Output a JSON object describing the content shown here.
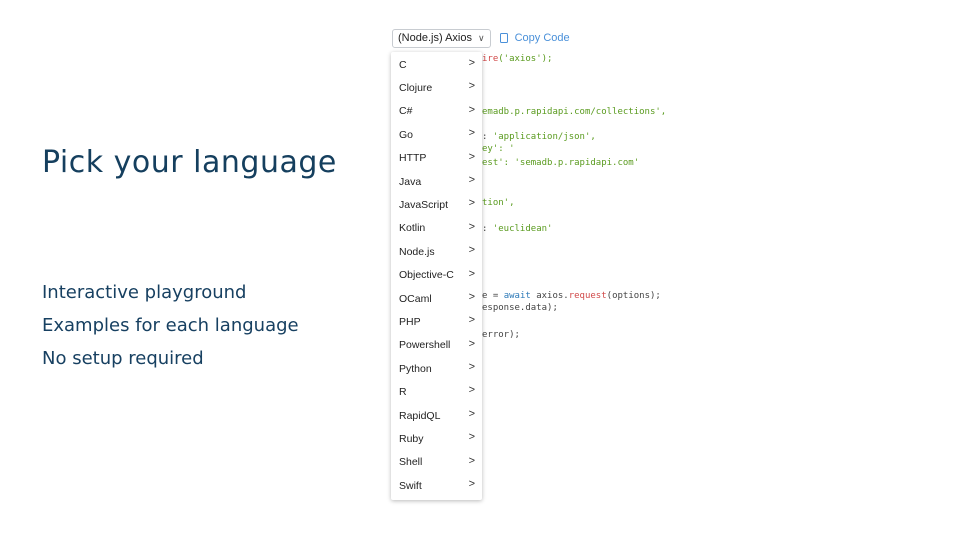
{
  "slide": {
    "title": "Pick your language",
    "features": [
      "Interactive playground",
      "Examples for each language",
      "No setup required"
    ]
  },
  "toolbar": {
    "selected_language": "(Node.js) Axios",
    "copy_label": "Copy Code"
  },
  "languages": [
    "C",
    "Clojure",
    "C#",
    "Go",
    "HTTP",
    "Java",
    "JavaScript",
    "Kotlin",
    "Node.js",
    "Objective-C",
    "OCaml",
    "PHP",
    "Powershell",
    "Python",
    "R",
    "RapidQL",
    "Ruby",
    "Shell",
    "Swift"
  ],
  "submenu_arrow": ">",
  "code_fragments": [
    {
      "parts": [
        {
          "t": "ire",
          "c": "fn"
        },
        {
          "t": "('axios');",
          "c": "str"
        }
      ]
    },
    {
      "parts": [
        {
          "t": "emadb.p.rapidapi.com/collections',",
          "c": "str"
        }
      ]
    },
    {
      "parts": [
        {
          "t": ": ",
          "c": "plain"
        },
        {
          "t": "'application/json',",
          "c": "str"
        }
      ]
    },
    {
      "parts": [
        {
          "t": "ey': '",
          "c": "str"
        }
      ]
    },
    {
      "parts": [
        {
          "t": "est': 'semadb.p.rapidapi.com'",
          "c": "str"
        }
      ]
    },
    {
      "parts": [
        {
          "t": "tion',",
          "c": "str"
        }
      ]
    },
    {
      "parts": [
        {
          "t": ": ",
          "c": "plain"
        },
        {
          "t": "'euclidean'",
          "c": "str"
        }
      ]
    },
    {
      "parts": [
        {
          "t": "e = ",
          "c": "plain"
        },
        {
          "t": "await",
          "c": "kw"
        },
        {
          "t": " axios.",
          "c": "plain"
        },
        {
          "t": "request",
          "c": "fn"
        },
        {
          "t": "(options);",
          "c": "plain"
        }
      ]
    },
    {
      "parts": [
        {
          "t": "esponse.data);",
          "c": "plain"
        }
      ]
    },
    {
      "parts": [
        {
          "t": "error);",
          "c": "plain"
        }
      ]
    }
  ]
}
